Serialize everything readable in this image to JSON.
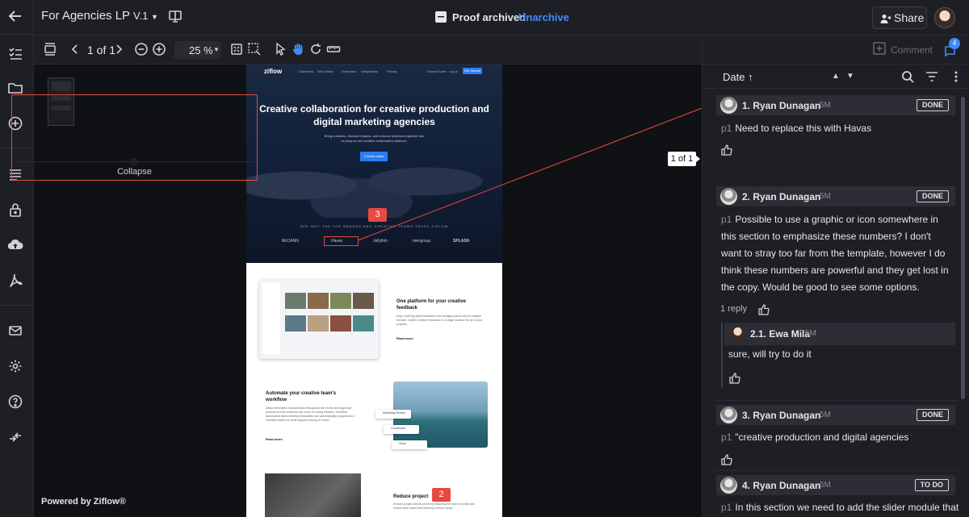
{
  "header": {
    "title": "For Agencies LP",
    "version": "V.1",
    "archived_text": "Proof archived",
    "unarchive_label": "Unarchive",
    "share_label": "Share"
  },
  "toolbar": {
    "page_indicator": "1 of 1",
    "zoom": "25 %",
    "comment_label": "Comment",
    "comments_count": "4"
  },
  "viewer": {
    "powered_by": "Powered by Ziflow®",
    "pager": "1 of 1"
  },
  "proof": {
    "logo": "ziflow",
    "nav": [
      "Customers",
      "Why Ziflow",
      "Enterprise",
      "Integrations",
      "Pricing",
      "Contact Sales",
      "Log in"
    ],
    "nav_cta": "Get Started",
    "hero_title": "Creative collaboration for creative production and digital marketing agencies",
    "hero_sub": "Bring creatives, decision makers, and external reviewers together into an easy-to-use creative collaboration platform.",
    "hero_button": "Contact sales",
    "brands_label": "SEE WHY THE TOP BRANDS AND CREATIVE TEAMS TRUST ZIFLOW",
    "brands": [
      "McCANN",
      "Havas",
      "Jellyfish",
      "mecgroup",
      "SPLASH"
    ],
    "section1_title": "One platform for your creative feedback",
    "section1_body": "Stop receiving client feedback from multiple places and in multiple formats. Gather creative feedback in a single location for all of your projects.",
    "section2_title": "Automate your creative team's workflow",
    "section2_body": "Ziflow eliminates manual tasks throughout the review and approval process so that creatives can focus on being creative. Workflow automation takes workflow templates and automatically progresses a workflow based on what happens during a review.",
    "section2_cards": [
      "Marketing Review",
      "Compliance",
      "Client"
    ],
    "section3_title": "Reduce project",
    "section3_body": "Reduce project delivery time by reducing the time to create and review each asset and reducing version creep.",
    "read_more": "Read more",
    "pin_3": "3",
    "pin_2": "2"
  },
  "panel": {
    "sort_label": "Date",
    "collapse_label": "Collapse"
  },
  "comments": [
    {
      "name": "1. Ryan Dunagan",
      "time": "5M",
      "status": "DONE",
      "page": "p1",
      "text": "Need to replace this with Havas"
    },
    {
      "name": "2. Ryan Dunagan",
      "time": "5M",
      "status": "DONE",
      "page": "p1",
      "text": "Possible to use a graphic or icon somewhere in this section to emphasize these numbers? I don't want to stray too far from the template, however I do think these numbers are powerful and they get lost in the copy. Would be good to see some options.",
      "replies_label": "1 reply"
    },
    {
      "name": "3. Ryan Dunagan",
      "time": "5M",
      "status": "DONE",
      "page": "p1",
      "text": "\"creative production and digital agencies"
    },
    {
      "name": "4. Ryan Dunagan",
      "time": "5M",
      "status": "TO DO",
      "page": "p1",
      "text": "In this section we need to add the slider module that"
    }
  ],
  "reply": {
    "name": "2.1. Ewa Mila",
    "time": "5M",
    "text": "sure, will try to do it"
  },
  "colors": {
    "accent": "#3f8cf7",
    "annotation": "#e8493f",
    "panel_bg": "#1e1f25",
    "viewer_bg": "#101114"
  }
}
